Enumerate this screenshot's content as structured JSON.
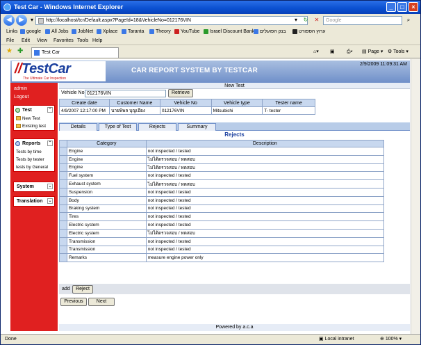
{
  "window": {
    "title": "Test Car - Windows Internet Explorer"
  },
  "address": {
    "url": "http://localhost/tcr/Default.aspx?PageId=18&VehicleNo=012176VIN",
    "search_placeholder": "Google"
  },
  "links": {
    "label": "Links",
    "items": [
      "google",
      "All Jobs",
      "JobNet",
      "Xplace",
      "Taranta",
      "Theory",
      "YouTube",
      "Israel Discount Bank",
      "בנק הפועלים",
      "ערוץ הספורט"
    ]
  },
  "menu": [
    "File",
    "Edit",
    "View",
    "Favorites",
    "Tools",
    "Help"
  ],
  "tab": {
    "title": "Test Car"
  },
  "commands": {
    "page": "Page",
    "tools": "Tools"
  },
  "header": {
    "logo": "TestCar",
    "logo_tagline": "The Ultimate Car Inspection",
    "system_title": "CAR REPORT SYSTEM BY TESTCAR",
    "datetime": "2/9/2009 11:09:31 AM"
  },
  "sidebar": {
    "user": "admin",
    "logout": "Logout",
    "test": {
      "title": "Test",
      "items": [
        "New Test",
        "Existing test"
      ]
    },
    "reports": {
      "title": "Reports",
      "items": [
        "Tests by time",
        "Tests by tester",
        "tests by General"
      ]
    },
    "system": "System",
    "translation": "Translation"
  },
  "main": {
    "section_title": "New Test",
    "vehicle_label": "Vehicle No",
    "vehicle_value": "012176VIN",
    "retrieve": "Retrieve",
    "info_headers": [
      "Create date",
      "Customer Name",
      "Vehicle No",
      "Vehicle type",
      "Tester name"
    ],
    "info_row": [
      "4/9/2007 12:17:00 PM",
      "นายพิพล บุญเอียง",
      "012176VIN",
      "Mitsubishi",
      "T- tester"
    ],
    "tabs": [
      "Details",
      "Type of Test",
      "Rejects",
      "Summary"
    ],
    "rejects_title": "Rejects",
    "rejects_headers": [
      "Category",
      "Description"
    ],
    "rejects": [
      [
        "Engine",
        "not inspected / tested"
      ],
      [
        "Engine",
        "ไม่ได้ตรวจสอบ / ทดสอบ"
      ],
      [
        "Engine",
        "ไม่ได้ตรวจสอบ / ทดสอบ"
      ],
      [
        "Fuel system",
        "not inspected / tested"
      ],
      [
        "Exhaust system",
        "ไม่ได้ตรวจสอบ / ทดสอบ"
      ],
      [
        "Suspension",
        "not inspected / tested"
      ],
      [
        "Body",
        "not inspected / tested"
      ],
      [
        "Braking system",
        "not inspected / tested"
      ],
      [
        "Tires",
        "not inspected / tested"
      ],
      [
        "Electric system",
        "not inspected / tested"
      ],
      [
        "Electric system",
        "ไม่ได้ตรวจสอบ / ทดสอบ"
      ],
      [
        "Transmission",
        "not inspected / tested"
      ],
      [
        "Transmission",
        "not inspected / tested"
      ],
      [
        "Remarks",
        "measure engine power only"
      ]
    ],
    "add_label": "add",
    "reject_button": "Reject",
    "previous": "Previous",
    "next": "Next"
  },
  "footer": {
    "powered": "Powered by a.c.a"
  },
  "status": {
    "left": "Done",
    "zone": "Local intranet",
    "zoom": "100%"
  }
}
